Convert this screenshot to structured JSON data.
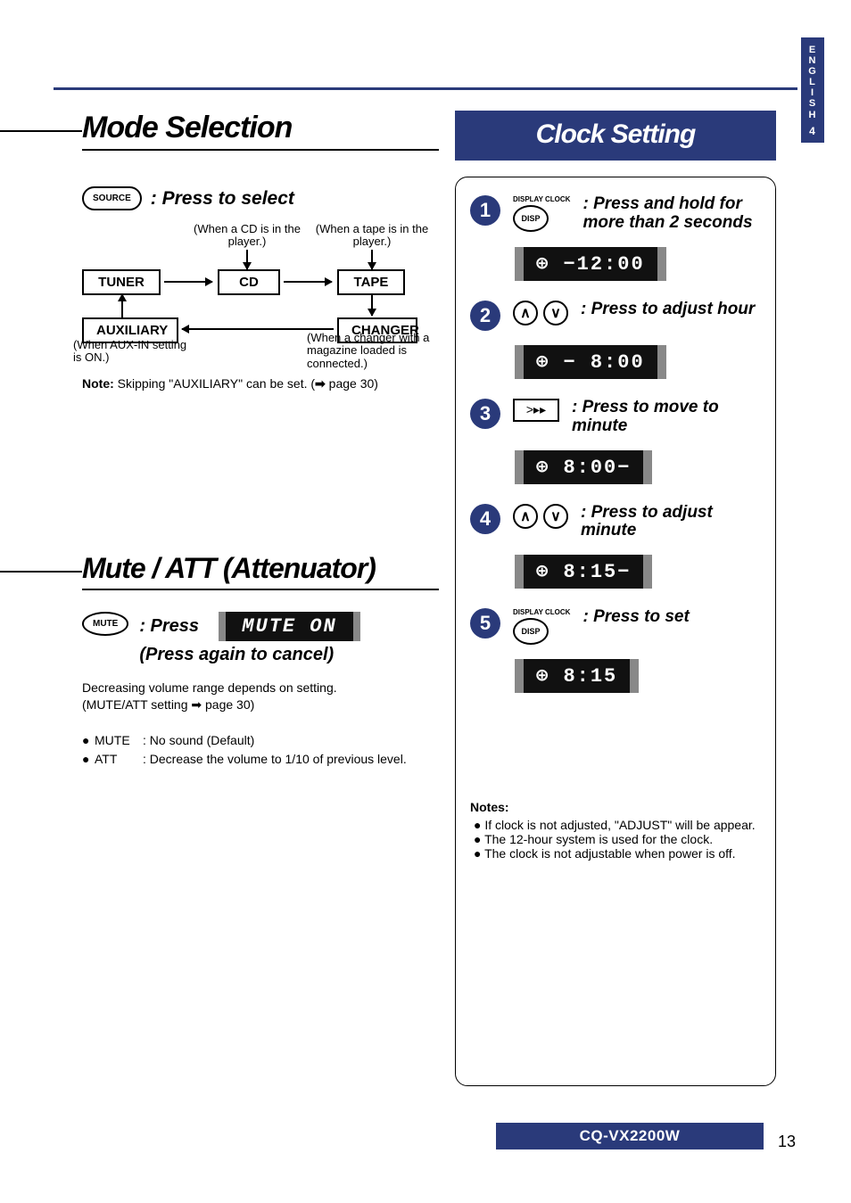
{
  "sideTab": {
    "lang": [
      "E",
      "N",
      "G",
      "L",
      "I",
      "S",
      "H"
    ],
    "num": "4"
  },
  "mode": {
    "title": "Mode Selection",
    "sourceBtn": "SOURCE",
    "pressSelect": ": Press to select",
    "captions": {
      "cd": "(When a CD is in the player.)",
      "tape": "(When a tape is in the player.)",
      "aux": "(When AUX-IN setting is ON.)",
      "changer": "(When a changer with a magazine loaded is connected.)"
    },
    "boxes": {
      "tuner": "TUNER",
      "cd": "CD",
      "tape": "TAPE",
      "auxiliary": "AUXILIARY",
      "changer": "CHANGER"
    },
    "noteLabel": "Note:",
    "noteText": " Skipping \"AUXILIARY\" can be set. (",
    "noteArrow": "➡",
    "notePage": " page 30)"
  },
  "mute": {
    "title": "Mute / ATT (Attenuator)",
    "btnLabel": "MUTE",
    "pressLabel": ": Press",
    "cancelLabel": "(Press again to cancel)",
    "lcd": "MUTE ON",
    "desc1": "Decreasing volume range depends on setting.",
    "desc2": "(MUTE/ATT setting ➡ page 30)",
    "bullets": [
      {
        "name": "MUTE",
        "desc": ": No sound (Default)"
      },
      {
        "name": "ATT",
        "desc": ": Decrease the volume to 1/10 of previous level."
      }
    ]
  },
  "clock": {
    "title": "Clock Setting",
    "displayClockLabel": "DISPLAY CLOCK",
    "dispBtn": "DISP",
    "steps": {
      "s1": {
        "text": ": Press and hold for more than 2 seconds",
        "lcd": "⊕ −12:00"
      },
      "s2": {
        "text": ": Press to adjust hour",
        "lcd": "⊕ − 8:00"
      },
      "s3": {
        "text": ": Press to move to minute",
        "lcd": "⊕   8:00−"
      },
      "s4": {
        "text": ": Press to adjust minute",
        "lcd": "⊕   8:15−"
      },
      "s5": {
        "text": ": Press to set",
        "lcd": "⊕   8:15"
      }
    },
    "notesLabel": "Notes:",
    "notes": [
      "If clock is not adjusted, \"ADJUST\" will be appear.",
      "The 12-hour system is used for the clock.",
      "The clock is not adjustable when power is off."
    ]
  },
  "footer": {
    "model": "CQ-VX2200W",
    "page": "13"
  }
}
